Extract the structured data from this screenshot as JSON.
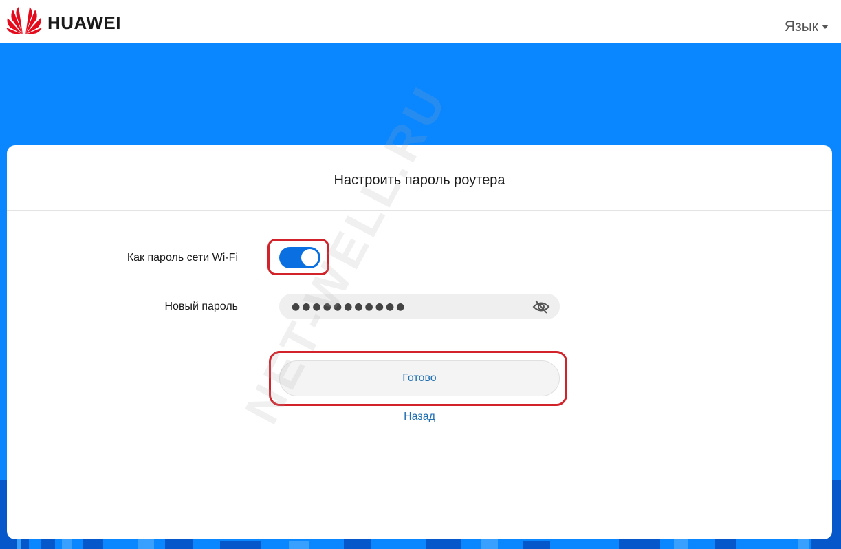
{
  "header": {
    "brand": "HUAWEI",
    "language_label": "Язык",
    "brand_colors": {
      "logo": "#e30b1c",
      "background": "#ffffff",
      "band": "#0a86ff"
    }
  },
  "card": {
    "title": "Настроить пароль роутера",
    "wifi_toggle": {
      "label": "Как пароль сети Wi-Fi",
      "state": "on"
    },
    "password": {
      "label": "Новый пароль",
      "value": "●●●●●●●●●●●",
      "icon": "eye-slash-icon"
    },
    "done_label": "Готово",
    "back_label": "Назад"
  },
  "watermark": "NET-WELL.RU",
  "colors": {
    "accent": "#0a6fe0",
    "link": "#1f6fb3",
    "highlight": "#d2232a"
  }
}
